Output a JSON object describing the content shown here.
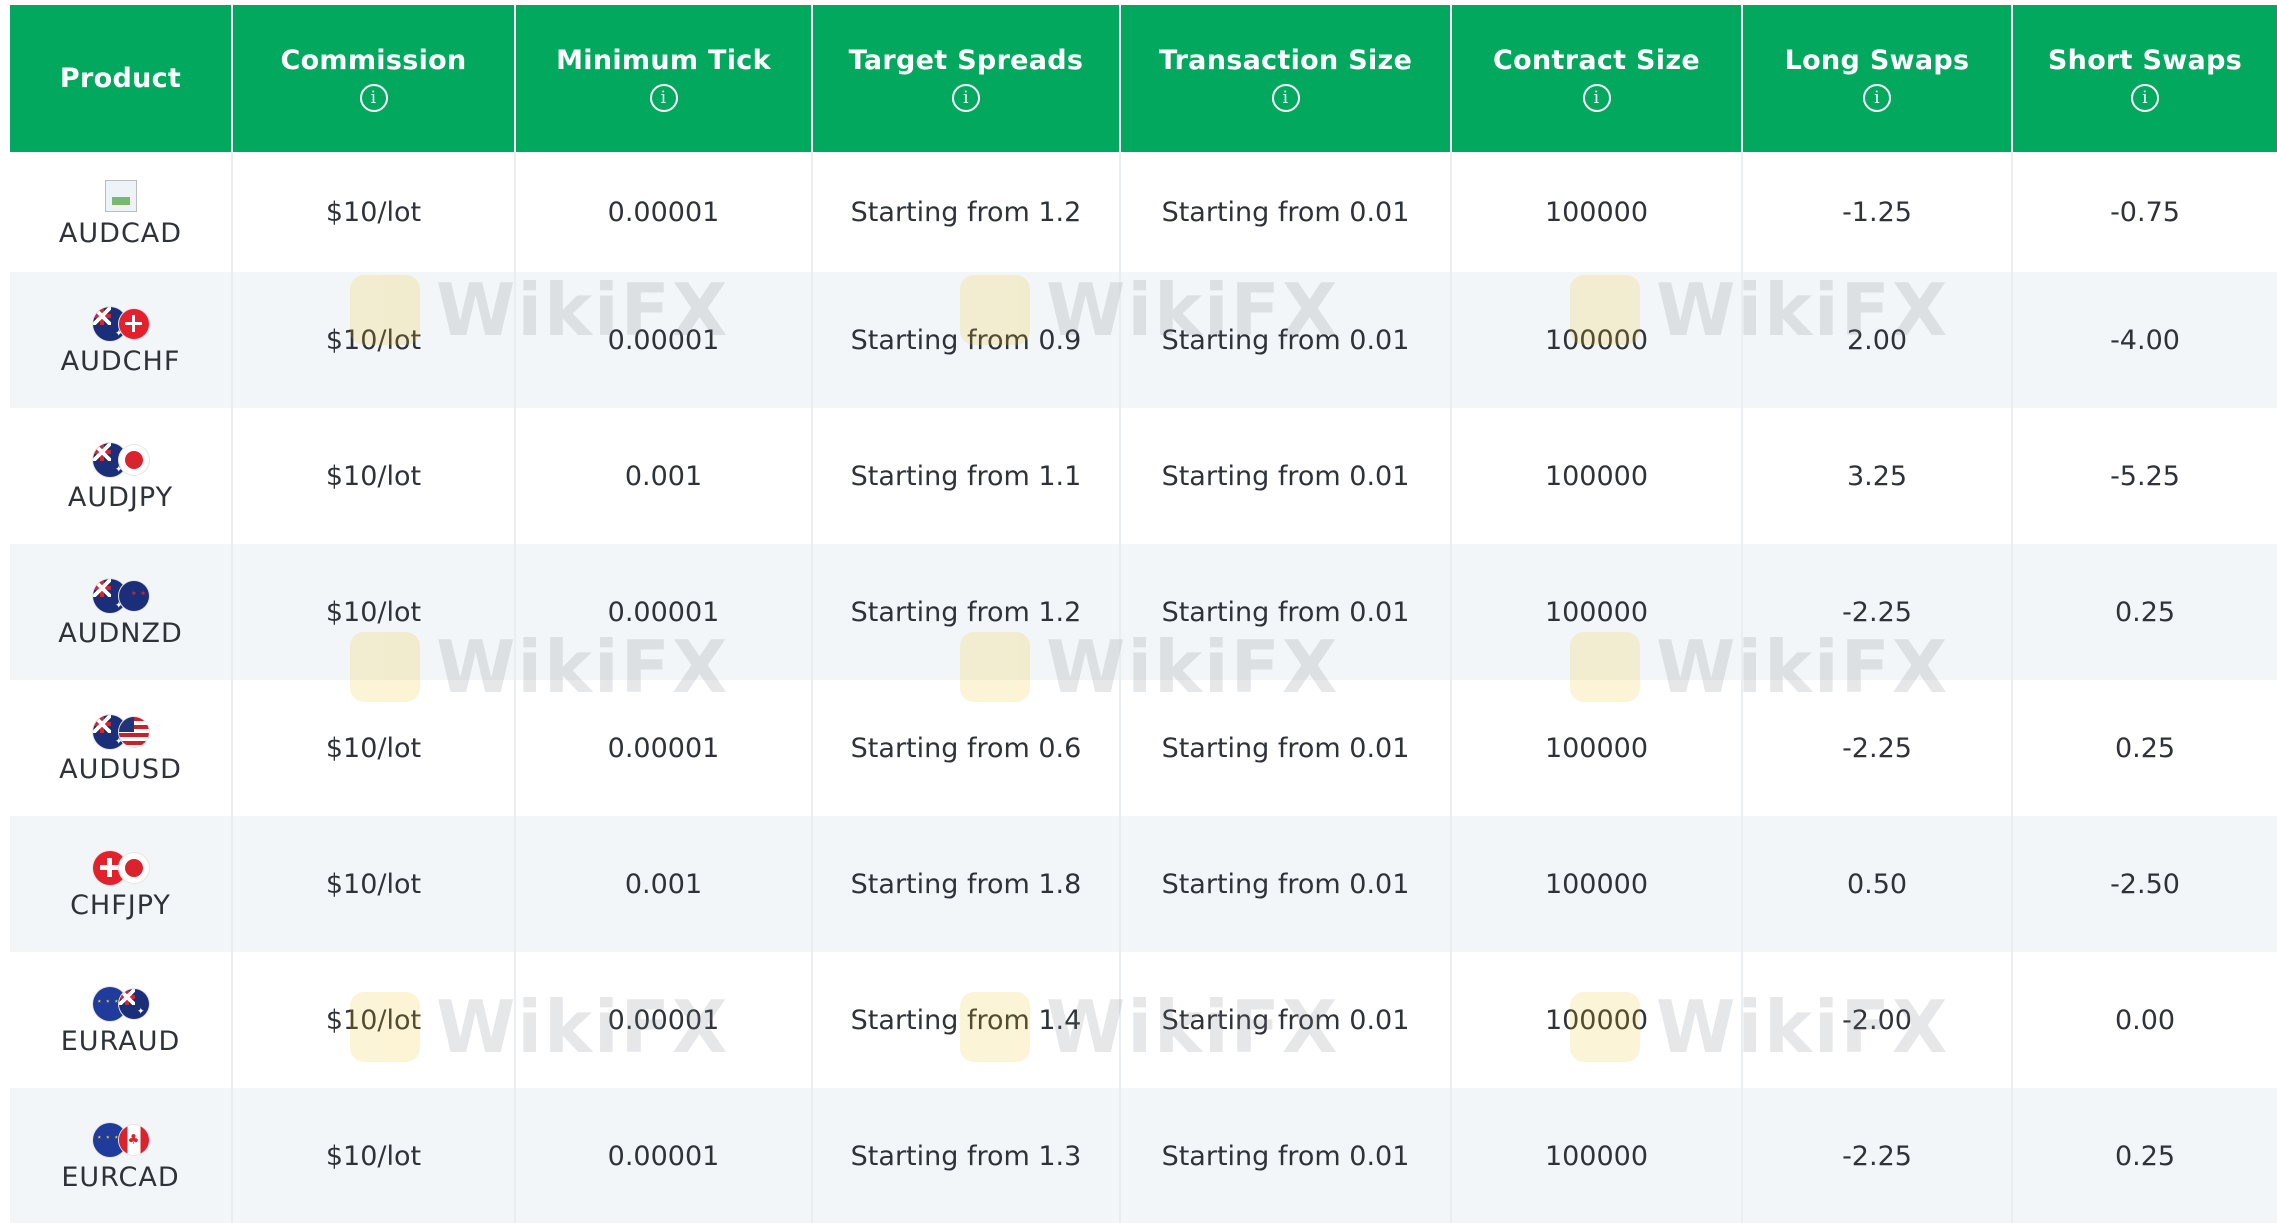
{
  "headers": [
    {
      "label": "Product",
      "info": false
    },
    {
      "label": "Commission",
      "info": true
    },
    {
      "label": "Minimum Tick",
      "info": true
    },
    {
      "label": "Target Spreads",
      "info": true
    },
    {
      "label": "Transaction Size",
      "info": true
    },
    {
      "label": "Contract Size",
      "info": true
    },
    {
      "label": "Long Swaps",
      "info": true
    },
    {
      "label": "Short Swaps",
      "info": true
    }
  ],
  "info_glyph": "i",
  "watermark_text": "WikiFX",
  "colors": {
    "header_bg": "#03a85f",
    "header_text": "#ffffff",
    "row_alt_bg": "#f3f6f8",
    "body_text": "#2f3338"
  },
  "rows": [
    {
      "product": "AUDCAD",
      "flags": [
        "broken-image-icon"
      ],
      "commission": "$10/lot",
      "min_tick": "0.00001",
      "spread": "Starting from 1.2",
      "transaction": "Starting from 0.01",
      "contract": "100000",
      "long_swap": "-1.25",
      "short_swap": "-0.75"
    },
    {
      "product": "AUDCHF",
      "flags": [
        "aud",
        "chf"
      ],
      "commission": "$10/lot",
      "min_tick": "0.00001",
      "spread": "Starting from 0.9",
      "transaction": "Starting from 0.01",
      "contract": "100000",
      "long_swap": "2.00",
      "short_swap": "-4.00"
    },
    {
      "product": "AUDJPY",
      "flags": [
        "aud",
        "jpy"
      ],
      "commission": "$10/lot",
      "min_tick": "0.001",
      "spread": "Starting from 1.1",
      "transaction": "Starting from 0.01",
      "contract": "100000",
      "long_swap": "3.25",
      "short_swap": "-5.25"
    },
    {
      "product": "AUDNZD",
      "flags": [
        "aud",
        "nzd"
      ],
      "commission": "$10/lot",
      "min_tick": "0.00001",
      "spread": "Starting from 1.2",
      "transaction": "Starting from 0.01",
      "contract": "100000",
      "long_swap": "-2.25",
      "short_swap": "0.25"
    },
    {
      "product": "AUDUSD",
      "flags": [
        "aud",
        "usd"
      ],
      "commission": "$10/lot",
      "min_tick": "0.00001",
      "spread": "Starting from 0.6",
      "transaction": "Starting from 0.01",
      "contract": "100000",
      "long_swap": "-2.25",
      "short_swap": "0.25"
    },
    {
      "product": "CHFJPY",
      "flags": [
        "chf",
        "jpy"
      ],
      "commission": "$10/lot",
      "min_tick": "0.001",
      "spread": "Starting from 1.8",
      "transaction": "Starting from 0.01",
      "contract": "100000",
      "long_swap": "0.50",
      "short_swap": "-2.50"
    },
    {
      "product": "EURAUD",
      "flags": [
        "eur",
        "aud"
      ],
      "commission": "$10/lot",
      "min_tick": "0.00001",
      "spread": "Starting from 1.4",
      "transaction": "Starting from 0.01",
      "contract": "100000",
      "long_swap": "-2.00",
      "short_swap": "0.00"
    },
    {
      "product": "EURCAD",
      "flags": [
        "eur",
        "cad"
      ],
      "commission": "$10/lot",
      "min_tick": "0.00001",
      "spread": "Starting from 1.3",
      "transaction": "Starting from 0.01",
      "contract": "100000",
      "long_swap": "-2.25",
      "short_swap": "0.25"
    }
  ]
}
